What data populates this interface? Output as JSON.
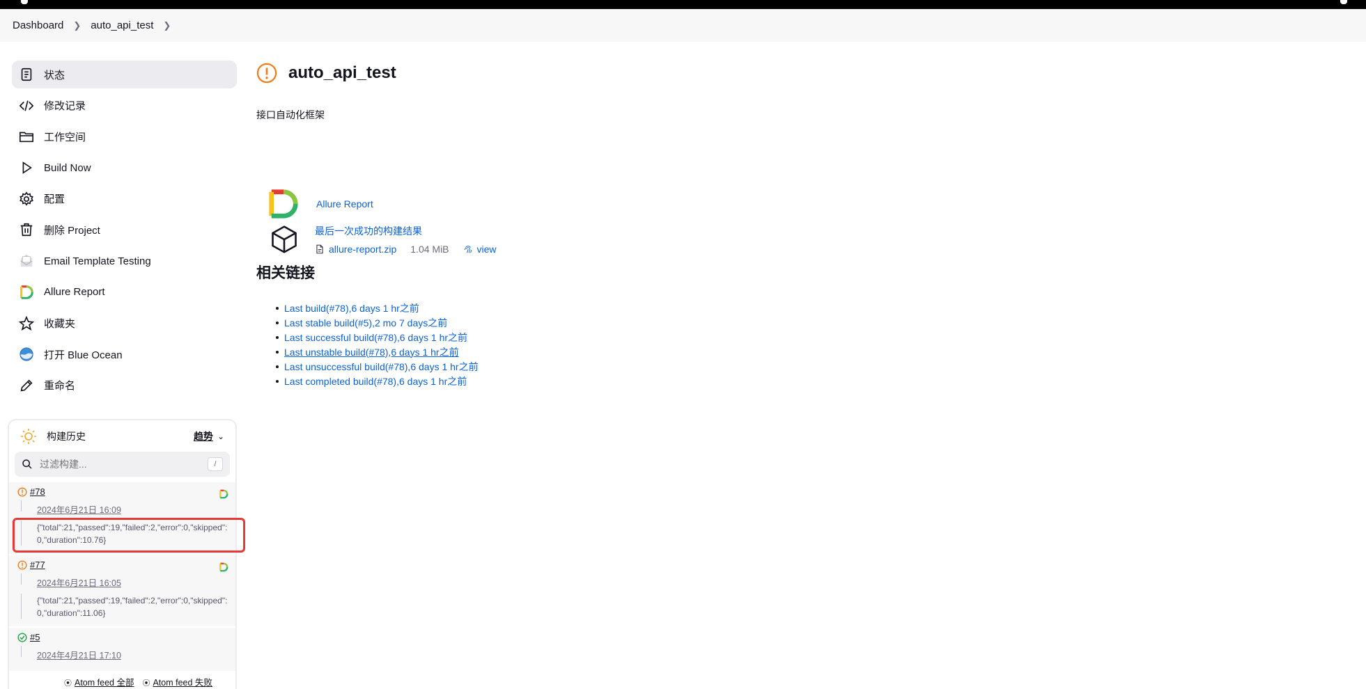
{
  "colors": {
    "accent": "#0b61d6",
    "warning": "#f07f1a",
    "success": "#1ea446",
    "highlight": "#e53935"
  },
  "breadcrumb": [
    "Dashboard",
    "auto_api_test"
  ],
  "sidebar": {
    "tasks": [
      {
        "label": "状态",
        "icon": "status-doc-icon"
      },
      {
        "label": "修改记录",
        "icon": "code-icon"
      },
      {
        "label": "工作空间",
        "icon": "folder-icon"
      },
      {
        "label": "Build Now",
        "icon": "play-icon"
      },
      {
        "label": "配置",
        "icon": "gear-icon"
      },
      {
        "label": "删除 Project",
        "icon": "trash-icon"
      },
      {
        "label": "Email Template Testing",
        "icon": "email-icon"
      },
      {
        "label": "Allure Report",
        "icon": "allure-icon"
      },
      {
        "label": "收藏夹",
        "icon": "star-icon"
      },
      {
        "label": "打开 Blue Ocean",
        "icon": "blue-ocean-icon"
      },
      {
        "label": "重命名",
        "icon": "pencil-icon"
      }
    ]
  },
  "history": {
    "title": "构建历史",
    "trend": "趋势",
    "filter_placeholder": "过滤构建...",
    "shortcut": "/",
    "builds": [
      {
        "number": "#78",
        "date": "2024年6月21日 16:09",
        "description": "{\"total\":21,\"passed\":19,\"failed\":2,\"error\":0,\"skipped\":0,\"duration\":10.76}"
      },
      {
        "number": "#77",
        "date": "2024年6月21日 16:05",
        "description": "{\"total\":21,\"passed\":19,\"failed\":2,\"error\":0,\"skipped\":0,\"duration\":11.06}"
      },
      {
        "number": "#5",
        "date": "2024年4月21日 17:10"
      }
    ],
    "atom_all": "Atom feed 全部",
    "atom_failed": "Atom feed 失败"
  },
  "main": {
    "title": "auto_api_test",
    "description": "接口自动化框架",
    "allure_link": "Allure Report",
    "last_success_link": "最后一次成功的构建结果",
    "artifact": {
      "name": "allure-report.zip",
      "size": "1.04 MiB",
      "view": "view"
    },
    "related_heading": "相关链接",
    "permalinks": [
      "Last build(#78),6 days 1 hr之前",
      "Last stable build(#5),2 mo 7 days之前",
      "Last successful build(#78),6 days 1 hr之前",
      "Last unstable build(#78),6 days 1 hr之前",
      "Last unsuccessful build(#78),6 days 1 hr之前",
      "Last completed build(#78),6 days 1 hr之前"
    ]
  }
}
